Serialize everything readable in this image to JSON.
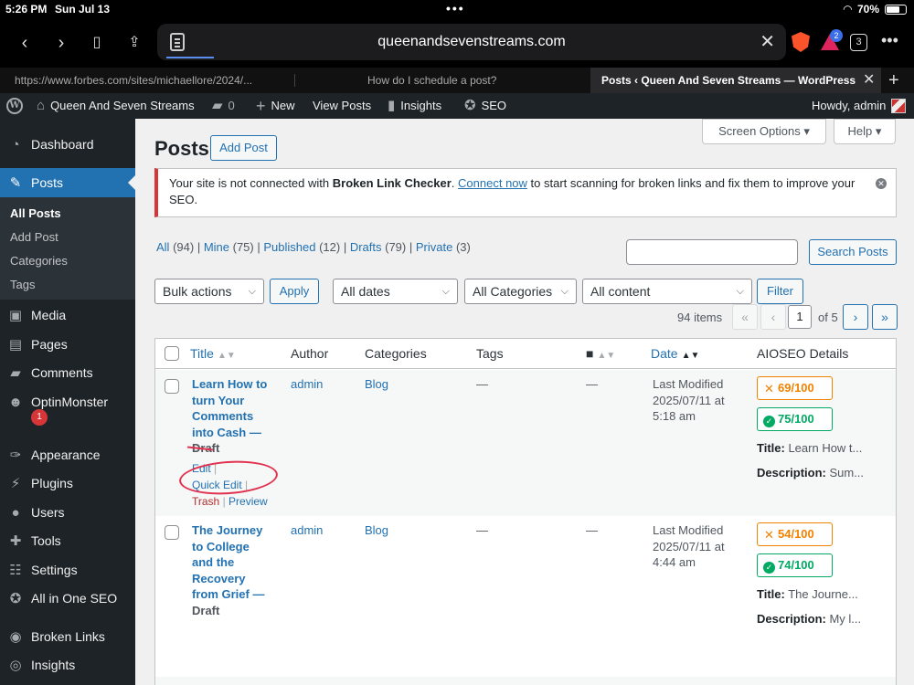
{
  "status": {
    "time": "5:26 PM",
    "date": "Sun Jul 13",
    "battery": "70%"
  },
  "browser": {
    "url": "queenandsevenstreams.com",
    "tab_count": "3",
    "alert_count": "2",
    "tabs": [
      {
        "title": "https://www.forbes.com/sites/michaellore/2024/..."
      },
      {
        "title": "How do I schedule a post?"
      },
      {
        "title": "Posts ‹ Queen And Seven Streams — WordPress"
      }
    ]
  },
  "adminbar": {
    "site_name": "Queen And Seven Streams",
    "comments_count": "0",
    "new_label": "New",
    "view_posts": "View Posts",
    "insights": "Insights",
    "seo": "SEO",
    "howdy": "Howdy, admin"
  },
  "sidebar": {
    "items": [
      {
        "label": "Dashboard",
        "icon": "dashboard-icon"
      },
      {
        "label": "Posts",
        "icon": "pin-icon"
      },
      {
        "label": "Media",
        "icon": "media-icon"
      },
      {
        "label": "Pages",
        "icon": "pages-icon"
      },
      {
        "label": "Comments",
        "icon": "comment-icon"
      },
      {
        "label": "OptinMonster",
        "icon": "optinmonster-icon"
      },
      {
        "label": "Appearance",
        "icon": "paintbrush-icon"
      },
      {
        "label": "Plugins",
        "icon": "plugin-icon"
      },
      {
        "label": "Users",
        "icon": "users-icon"
      },
      {
        "label": "Tools",
        "icon": "wrench-icon"
      },
      {
        "label": "Settings",
        "icon": "settings-icon"
      },
      {
        "label": "All in One SEO",
        "icon": "aioseo-icon"
      },
      {
        "label": "Broken Links",
        "icon": "broken-link-icon"
      },
      {
        "label": "Insights",
        "icon": "insights-icon"
      }
    ],
    "submenu": [
      "All Posts",
      "Add Post",
      "Categories",
      "Tags"
    ],
    "optinmonster_badge": "1"
  },
  "main": {
    "title": "Posts",
    "add_post": "Add Post",
    "screen_options": "Screen Options",
    "help": "Help",
    "notice": {
      "before": "Your site is not connected with ",
      "bold": "Broken Link Checker",
      "after_bold": ". ",
      "link": "Connect now",
      "tail": " to start scanning for broken links and fix them to improve your SEO."
    },
    "filters_view": [
      {
        "label": "All",
        "count": "(94)"
      },
      {
        "label": "Mine",
        "count": "(75)"
      },
      {
        "label": "Published",
        "count": "(12)"
      },
      {
        "label": "Drafts",
        "count": "(79)"
      },
      {
        "label": "Private",
        "count": "(3)"
      }
    ],
    "search_button": "Search Posts",
    "search_value": "",
    "bulk_actions": "Bulk actions",
    "apply": "Apply",
    "all_dates": "All dates",
    "all_categories": "All Categories",
    "all_content": "All content",
    "filter": "Filter",
    "items_count": "94 items",
    "pagination": {
      "first": "«",
      "prev": "‹",
      "current": "1",
      "of": "of 5",
      "next": "›",
      "last": "»"
    },
    "columns": [
      "Title",
      "Author",
      "Categories",
      "Tags",
      "Date",
      "AIOSEO Details"
    ],
    "rows": [
      {
        "title_lines": [
          "Learn How to",
          "turn Your",
          "Comments",
          "into Cash —"
        ],
        "state": "Draft",
        "actions": {
          "edit": "Edit",
          "quick_edit": "Quick Edit",
          "trash": "Trash",
          "preview": "Preview"
        },
        "author": "admin",
        "category": "Blog",
        "tags": "—",
        "comments": "—",
        "date_lines": [
          "Last Modified",
          "2025/07/11 at",
          "5:18 am"
        ],
        "truseo": "69/100",
        "headline": "75/100",
        "seo_title_label": "Title:",
        "seo_title": "Learn How t...",
        "seo_desc_label": "Description:",
        "seo_desc": "Sum..."
      },
      {
        "title_lines": [
          "The Journey",
          "to College",
          "and the",
          "Recovery",
          "from Grief —"
        ],
        "state": "Draft",
        "author": "admin",
        "category": "Blog",
        "tags": "—",
        "comments": "—",
        "date_lines": [
          "Last Modified",
          "2025/07/11 at",
          "4:44 am"
        ],
        "truseo": "54/100",
        "headline": "74/100",
        "seo_title_label": "Title:",
        "seo_title": "The Journe...",
        "seo_desc_label": "Description:",
        "seo_desc": "My l..."
      }
    ]
  },
  "colors": {
    "wp_blue": "#2271b1",
    "admin_dark": "#1d2327",
    "score_orange": "#f18200",
    "score_green": "#00aa63",
    "annotation_red": "#e0314f"
  }
}
